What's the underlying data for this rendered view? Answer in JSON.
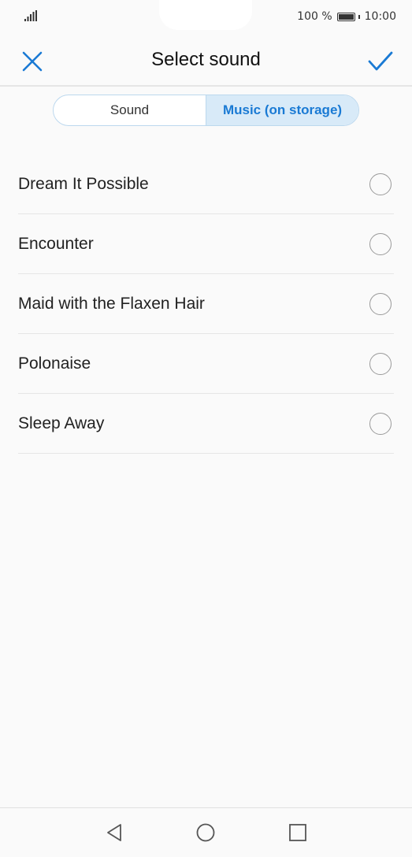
{
  "status_bar": {
    "battery_percent": "100 %",
    "time": "10:00",
    "icons": [
      "signal-icon",
      "battery-icon"
    ]
  },
  "header": {
    "title": "Select sound",
    "close_icon": "close-icon",
    "confirm_icon": "checkmark-icon",
    "accent_color": "#1a7ad4"
  },
  "tabs": [
    {
      "label": "Sound",
      "selected": false
    },
    {
      "label": "Music (on storage)",
      "selected": true
    }
  ],
  "sounds": [
    {
      "label": "Dream It Possible",
      "selected": false
    },
    {
      "label": "Encounter",
      "selected": false
    },
    {
      "label": "Maid with the Flaxen Hair",
      "selected": false
    },
    {
      "label": "Polonaise",
      "selected": false
    },
    {
      "label": "Sleep Away",
      "selected": false
    }
  ],
  "nav_bar": {
    "icons": [
      "back-icon",
      "home-icon",
      "recents-icon"
    ]
  }
}
